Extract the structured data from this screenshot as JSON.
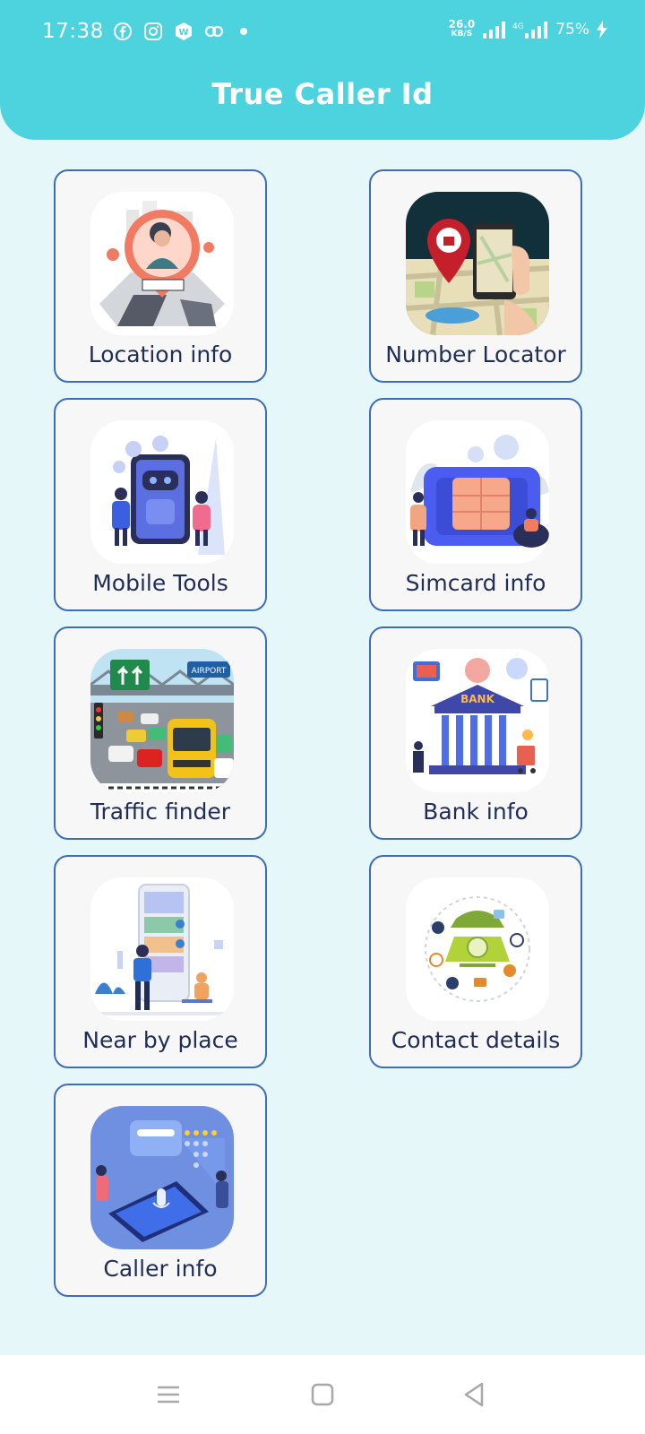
{
  "status_bar": {
    "time": "17:38",
    "net_speed_value": "26.0",
    "net_speed_unit": "KB/S",
    "battery": "75%",
    "icons": [
      "facebook-icon",
      "instagram-icon",
      "w-badge-icon",
      "link-icon",
      "notification-dot",
      "signal-icon",
      "4g-signal-icon",
      "charging-icon"
    ]
  },
  "header": {
    "title": "True Caller Id",
    "color": "#4dd3dd"
  },
  "menu": {
    "items": [
      {
        "label": "Location info"
      },
      {
        "label": "Number Locator"
      },
      {
        "label": "Mobile Tools"
      },
      {
        "label": "Simcard info"
      },
      {
        "label": "Traffic finder"
      },
      {
        "label": "Bank info"
      },
      {
        "label": "Near by place"
      },
      {
        "label": "Contact details"
      },
      {
        "label": "Caller info"
      }
    ]
  },
  "nav_bar": {
    "buttons": [
      "menu-icon",
      "home-icon",
      "back-icon"
    ]
  },
  "colors": {
    "background": "#e6f7fa",
    "card_border": "#3b6eb8",
    "label_text": "#1f2d57"
  }
}
